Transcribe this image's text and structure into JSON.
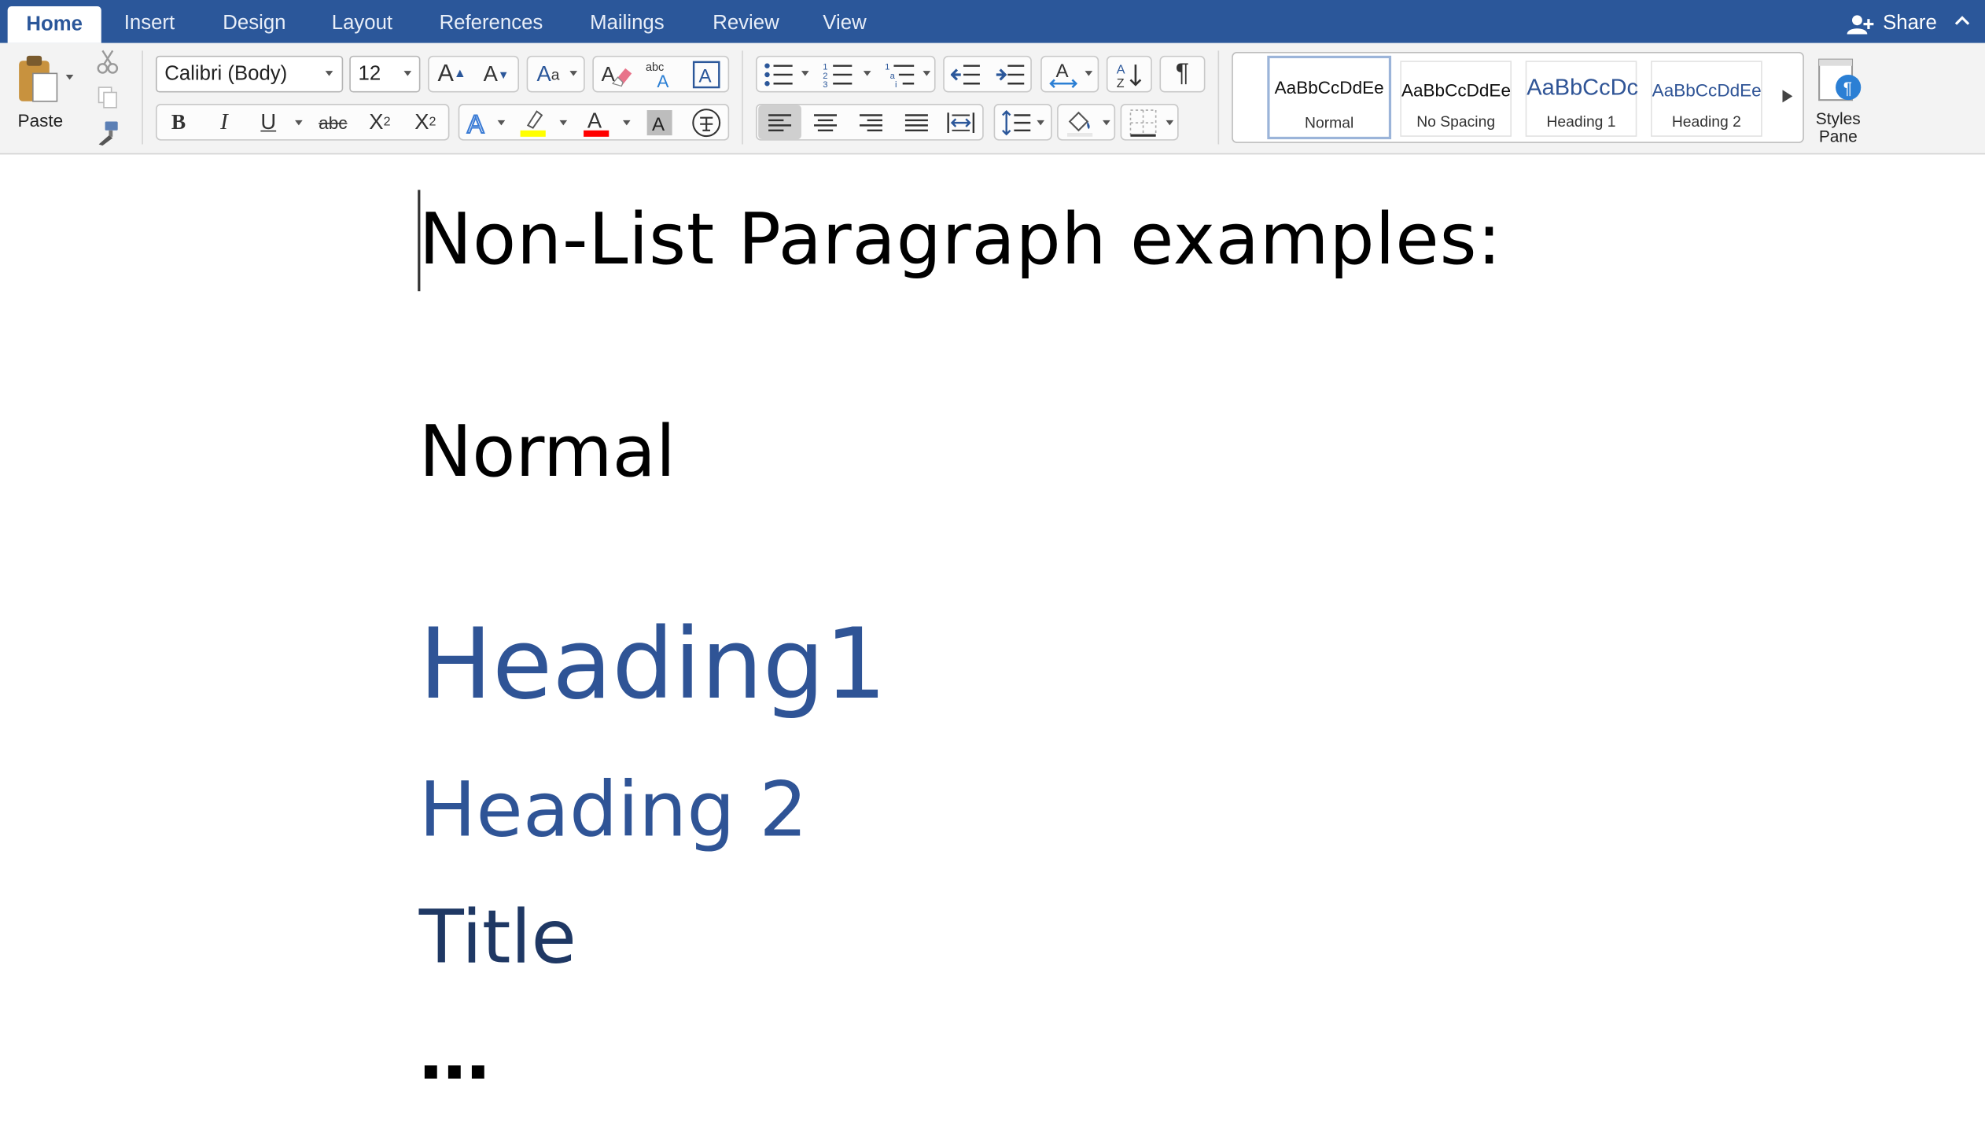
{
  "tabs": [
    {
      "label": "Home",
      "active": true
    },
    {
      "label": "Insert"
    },
    {
      "label": "Design"
    },
    {
      "label": "Layout"
    },
    {
      "label": "References"
    },
    {
      "label": "Mailings"
    },
    {
      "label": "Review"
    },
    {
      "label": "View"
    }
  ],
  "share": {
    "label": "Share"
  },
  "clipboard": {
    "paste_label": "Paste"
  },
  "font": {
    "name": "Calibri (Body)",
    "size": "12"
  },
  "styles_gallery": [
    {
      "sample": "AaBbCcDdEe",
      "name": "Normal",
      "selected": true
    },
    {
      "sample": "AaBbCcDdEe",
      "name": "No Spacing"
    },
    {
      "sample": "AaBbCcDc",
      "name": "Heading 1"
    },
    {
      "sample": "AaBbCcDdEe",
      "name": "Heading 2"
    }
  ],
  "styles_pane": {
    "line1": "Styles",
    "line2": "Pane"
  },
  "document": {
    "paragraphs": [
      {
        "text": "Non-List Paragraph examples:",
        "style": "Normal"
      },
      {
        "text": "Normal",
        "style": "Normal"
      },
      {
        "text": "Heading1",
        "style": "Heading 1"
      },
      {
        "text": "Heading 2",
        "style": "Heading 2"
      },
      {
        "text": "Title",
        "style": "Title"
      },
      {
        "text": "…",
        "style": "Normal"
      }
    ]
  },
  "colors": {
    "ribbon_blue": "#2b579a",
    "heading_blue": "#2f5496",
    "title_navy": "#1f3864",
    "highlight_yellow": "#ffff00",
    "font_color_red": "#ff0000"
  }
}
